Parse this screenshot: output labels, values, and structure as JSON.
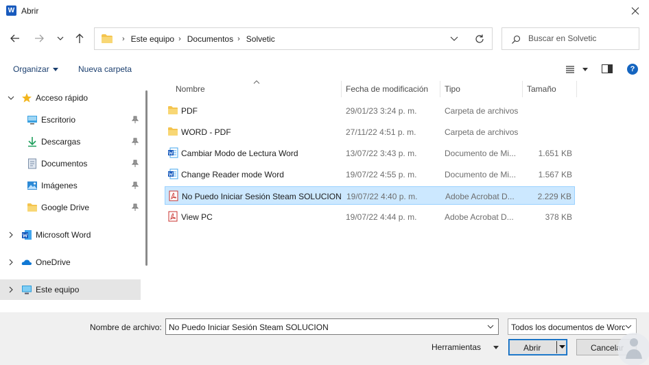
{
  "window": {
    "title": "Abrir",
    "app_icon_letter": "W"
  },
  "address": {
    "crumbs": [
      "Este equipo",
      "Documentos",
      "Solvetic"
    ]
  },
  "search": {
    "placeholder": "Buscar en Solvetic"
  },
  "toolbar": {
    "organize_label": "Organizar",
    "new_folder_label": "Nueva carpeta",
    "help_glyph": "?"
  },
  "nav": {
    "quick_access": {
      "label": "Acceso rápido"
    },
    "quick_items": [
      {
        "label": "Escritorio",
        "icon": "desktop-icon"
      },
      {
        "label": "Descargas",
        "icon": "download-icon"
      },
      {
        "label": "Documentos",
        "icon": "documents-icon"
      },
      {
        "label": "Imágenes",
        "icon": "pictures-icon"
      },
      {
        "label": "Google Drive",
        "icon": "folder-icon"
      }
    ],
    "roots": [
      {
        "label": "Microsoft Word",
        "icon": "word-icon"
      },
      {
        "label": "OneDrive",
        "icon": "onedrive-icon"
      },
      {
        "label": "Este equipo",
        "icon": "computer-icon",
        "selected": true
      }
    ]
  },
  "columns": {
    "name": "Nombre",
    "date": "Fecha de modificación",
    "type": "Tipo",
    "size": "Tamaño"
  },
  "files": [
    {
      "name": "PDF",
      "date": "29/01/23 3:24 p. m.",
      "type": "Carpeta de archivos",
      "size": "",
      "icon": "folder-icon"
    },
    {
      "name": "WORD - PDF",
      "date": "27/11/22 4:51 p. m.",
      "type": "Carpeta de archivos",
      "size": "",
      "icon": "folder-icon"
    },
    {
      "name": "Cambiar Modo de Lectura Word",
      "date": "13/07/22 3:43 p. m.",
      "type": "Documento de Mi...",
      "size": "1.651 KB",
      "icon": "word-doc-icon"
    },
    {
      "name": "Change Reader mode Word",
      "date": "19/07/22 4:55 p. m.",
      "type": "Documento de Mi...",
      "size": "1.567 KB",
      "icon": "word-doc-icon"
    },
    {
      "name": "No Puedo Iniciar Sesión Steam  SOLUCION",
      "date": "19/07/22 4:40 p. m.",
      "type": "Adobe Acrobat D...",
      "size": "2.229 KB",
      "icon": "pdf-icon",
      "selected": true
    },
    {
      "name": "View PC",
      "date": "19/07/22 4:44 p. m.",
      "type": "Adobe Acrobat D...",
      "size": "378 KB",
      "icon": "pdf-icon"
    }
  ],
  "footer": {
    "filename_label": "Nombre de archivo:",
    "filename_value": "No Puedo Iniciar Sesión Steam  SOLUCION",
    "filetype_value": "Todos los documentos de Word",
    "tools_label": "Herramientas",
    "open_label": "Abrir",
    "cancel_label": "Cancelar"
  },
  "colors": {
    "selection_bg": "#cce8ff",
    "selection_border": "#99d1ff",
    "accent": "#005fb8",
    "folder": "#f4c44e"
  }
}
